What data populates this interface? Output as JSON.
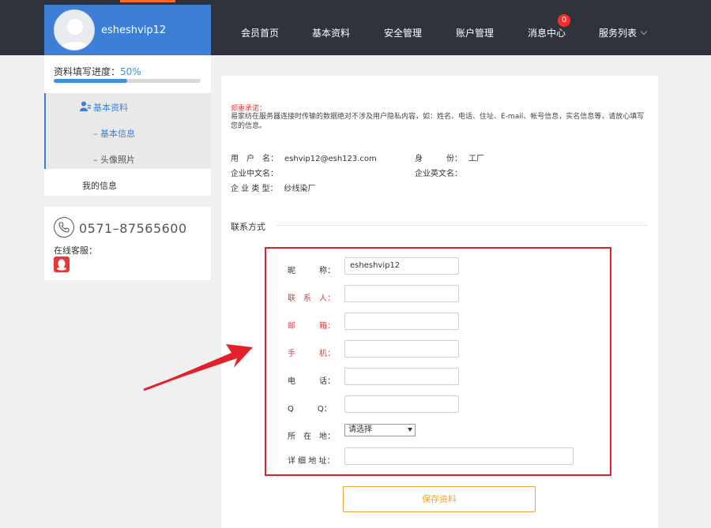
{
  "header": {
    "username": "esheshvip12",
    "nav": [
      "会员首页",
      "基本资料",
      "安全管理",
      "账户管理",
      "消息中心",
      "服务列表"
    ],
    "badge_count": "0"
  },
  "sidebar": {
    "progress_label": "资料填写进度：",
    "progress_value": "50%",
    "progress_fraction": 0.5,
    "menu_main": "基本资料",
    "menu_sub": [
      "– 基本信息",
      "– 头像照片"
    ],
    "my_info": "我的信息",
    "phone": "0571–87565600",
    "service_label": "在线客服："
  },
  "notice": {
    "title": "郑重承诺：",
    "body": "易家纺在服务器连接时传输的数据绝对不涉及用户隐私内容，如：姓名、电话、住址、E-mail、帐号信息，实名信息等，请放心填写您的信息。"
  },
  "info": {
    "username_label": "用　户　名：",
    "username_value": "eshvip12@esh123.com",
    "identity_label": "身　　　份：",
    "identity_value": "工厂",
    "company_cn_label": "企业中文名：",
    "company_en_label": "企业英文名：",
    "company_type_label": "企 业 类 型：",
    "company_type_value": "纱线染厂"
  },
  "contact": {
    "section_title": "联系方式",
    "nickname_label": "昵　　　称：",
    "nickname_value": "esheshvip12",
    "contact_person_label": "联　系　人：",
    "email_label": "邮　　　箱：",
    "mobile_label": "手　　　机：",
    "phone_label": "电　　　话：",
    "qq_label": "Q　　　Q：",
    "location_label": "所　在　地：",
    "location_selected": "请选择",
    "address_label": "详 细 地 址："
  },
  "actions": {
    "save_label": "保存资料"
  },
  "colors": {
    "header_bg": "#2f333e",
    "profile_bg": "#3e7fd6",
    "accent_red": "#e4212b",
    "save_orange": "#f0a33a",
    "progress_blue": "#3e8fe0"
  }
}
